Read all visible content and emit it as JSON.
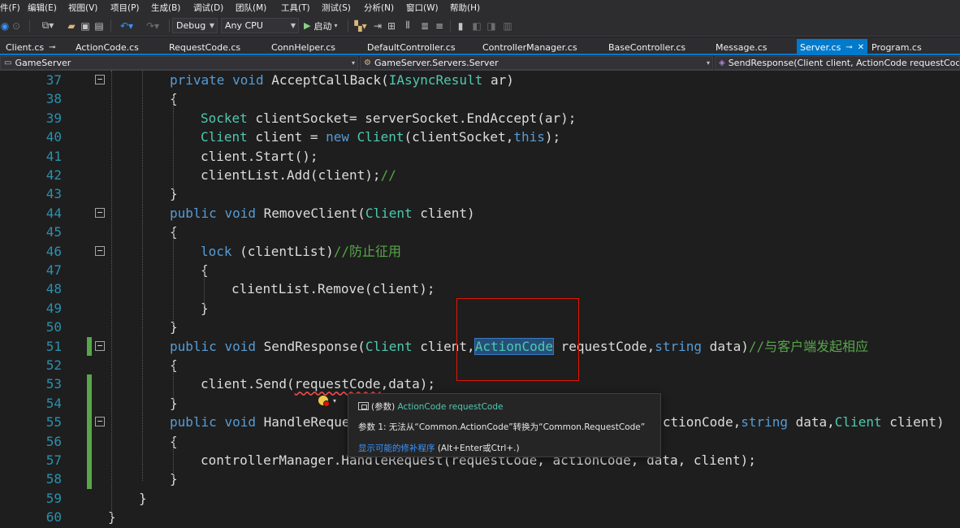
{
  "menu": [
    "件(F)",
    "编辑(E)",
    "视图(V)",
    "项目(P)",
    "生成(B)",
    "调试(D)",
    "团队(M)",
    "工具(T)",
    "测试(S)",
    "分析(N)",
    "窗口(W)",
    "帮助(H)"
  ],
  "toolbar": {
    "config": "Debug",
    "platform": "Any CPU",
    "start_label": "启动"
  },
  "tabs": [
    {
      "label": "Client.cs",
      "pinned": true
    },
    {
      "label": "ActionCode.cs"
    },
    {
      "label": "RequestCode.cs"
    },
    {
      "label": "ConnHelper.cs"
    },
    {
      "label": "DefaultController.cs"
    },
    {
      "label": "ControllerManager.cs"
    },
    {
      "label": "BaseController.cs"
    },
    {
      "label": "Message.cs"
    },
    {
      "label": "Server.cs",
      "active": true
    },
    {
      "label": "Program.cs"
    }
  ],
  "nav": {
    "project": "GameServer",
    "type": "GameServer.Servers.Server",
    "member": "SendResponse(Client client, ActionCode requestCode, string data)"
  },
  "lines": [
    {
      "n": "37",
      "tokens": [
        [
          "kw",
          "private"
        ],
        [
          "",
          " "
        ],
        [
          "kw",
          "void"
        ],
        [
          "",
          " AcceptCallBack("
        ],
        [
          "ty",
          "IAsyncResult"
        ],
        [
          "",
          " ar)"
        ]
      ]
    },
    {
      "n": "38",
      "tokens": [
        [
          "",
          "{"
        ]
      ]
    },
    {
      "n": "39",
      "tokens": [
        [
          "ty",
          "Socket"
        ],
        [
          "",
          " clientSocket= serverSocket.EndAccept(ar);"
        ]
      ]
    },
    {
      "n": "40",
      "tokens": [
        [
          "ty",
          "Client"
        ],
        [
          "",
          " client = "
        ],
        [
          "kw",
          "new"
        ],
        [
          "",
          " "
        ],
        [
          "ty",
          "Client"
        ],
        [
          "",
          "(clientSocket,"
        ],
        [
          "kw",
          "this"
        ],
        [
          "",
          ");"
        ]
      ]
    },
    {
      "n": "41",
      "tokens": [
        [
          "",
          "client.Start();"
        ]
      ]
    },
    {
      "n": "42",
      "tokens": [
        [
          "",
          "clientList.Add(client);"
        ],
        [
          "cm",
          "//"
        ]
      ]
    },
    {
      "n": "43",
      "tokens": [
        [
          "",
          "}"
        ]
      ]
    },
    {
      "n": "44",
      "tokens": [
        [
          "kw",
          "public"
        ],
        [
          "",
          " "
        ],
        [
          "kw",
          "void"
        ],
        [
          "",
          " RemoveClient("
        ],
        [
          "ty",
          "Client"
        ],
        [
          "",
          " client)"
        ]
      ]
    },
    {
      "n": "45",
      "tokens": [
        [
          "",
          "{"
        ]
      ]
    },
    {
      "n": "46",
      "tokens": [
        [
          "kw",
          "lock"
        ],
        [
          "",
          " (clientList)"
        ],
        [
          "cm",
          "//防止征用"
        ]
      ]
    },
    {
      "n": "47",
      "tokens": [
        [
          "",
          "{"
        ]
      ]
    },
    {
      "n": "48",
      "tokens": [
        [
          "",
          "clientList.Remove(client);"
        ]
      ]
    },
    {
      "n": "49",
      "tokens": [
        [
          "",
          "}"
        ]
      ]
    },
    {
      "n": "50",
      "tokens": [
        [
          "",
          "}"
        ]
      ]
    },
    {
      "n": "51",
      "tokens": [
        [
          "kw",
          "public"
        ],
        [
          "",
          " "
        ],
        [
          "kw",
          "void"
        ],
        [
          "",
          " SendResponse("
        ],
        [
          "ty",
          "Client"
        ],
        [
          "",
          " client,"
        ],
        [
          "hl",
          "ActionCode"
        ],
        [
          "",
          " requestCode,"
        ],
        [
          "kw",
          "string"
        ],
        [
          "",
          " data)"
        ],
        [
          "cm",
          "//与客户端发起相应"
        ]
      ]
    },
    {
      "n": "52",
      "tokens": [
        [
          "",
          "{"
        ]
      ]
    },
    {
      "n": "53",
      "tokens": [
        [
          "",
          "client.Send("
        ],
        [
          "err",
          "requestCode"
        ],
        [
          "",
          ",data);"
        ]
      ]
    },
    {
      "n": "54",
      "tokens": [
        [
          "",
          "}"
        ]
      ]
    },
    {
      "n": "55",
      "tokens": [
        [
          "kw",
          "public"
        ],
        [
          "",
          " "
        ],
        [
          "kw",
          "void"
        ],
        [
          "",
          " HandleReque"
        ],
        [
          "",
          "                                        ctionCode,"
        ],
        [
          "kw",
          "string"
        ],
        [
          "",
          " data,"
        ],
        [
          "ty",
          "Client"
        ],
        [
          "",
          " client)"
        ]
      ]
    },
    {
      "n": "56",
      "tokens": [
        [
          "",
          "{"
        ]
      ]
    },
    {
      "n": "57",
      "tokens": [
        [
          "",
          "controllerManager.HandleRequest(requestCode, actionCode, data, client);"
        ]
      ]
    },
    {
      "n": "58",
      "tokens": [
        [
          "",
          "}"
        ]
      ]
    },
    {
      "n": "59",
      "tokens": [
        [
          "",
          "}"
        ]
      ]
    },
    {
      "n": "60",
      "tokens": [
        [
          "",
          "}"
        ]
      ]
    }
  ],
  "tooltip": {
    "kind": "(参数)",
    "signature": "ActionCode requestCode",
    "error": "参数 1: 无法从“Common.ActionCode”转换为“Common.RequestCode”",
    "fix_link": "显示可能的修补程序",
    "fix_shortcut": " (Alt+Enter或Ctrl+.)"
  },
  "colors": {
    "editor_bg": "#1e1e1e",
    "keyword": "#569cd6",
    "type": "#4ec9b0",
    "comment": "#57a64a",
    "line_number": "#2b91af",
    "accent": "#007acc",
    "annotation": "#e51400"
  }
}
